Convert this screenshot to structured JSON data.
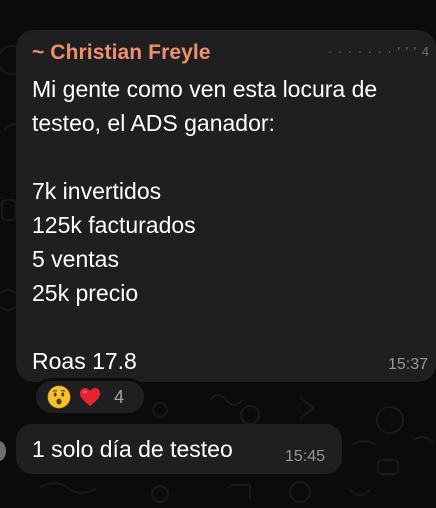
{
  "message": {
    "sender_name": "~ Christian Freyle",
    "sender_phone_fragment": "· · · · · · · ' ' ' 4",
    "lines": [
      "Mi gente como ven esta locura de",
      "testeo, el ADS ganador:",
      "",
      "7k invertidos",
      "125k facturados",
      "5 ventas",
      "25k precio",
      "",
      "Roas 17.8"
    ],
    "time": "15:37"
  },
  "reactions": {
    "emojis": [
      "hushed-face",
      "red-heart"
    ],
    "count": "4"
  },
  "reply": {
    "text": "1 solo día de testeo",
    "time": "15:45"
  },
  "colors": {
    "background": "#0b0b0b",
    "bubble": "#1f1f21",
    "sender_name": "#f2906c",
    "timestamp": "#98989c"
  }
}
